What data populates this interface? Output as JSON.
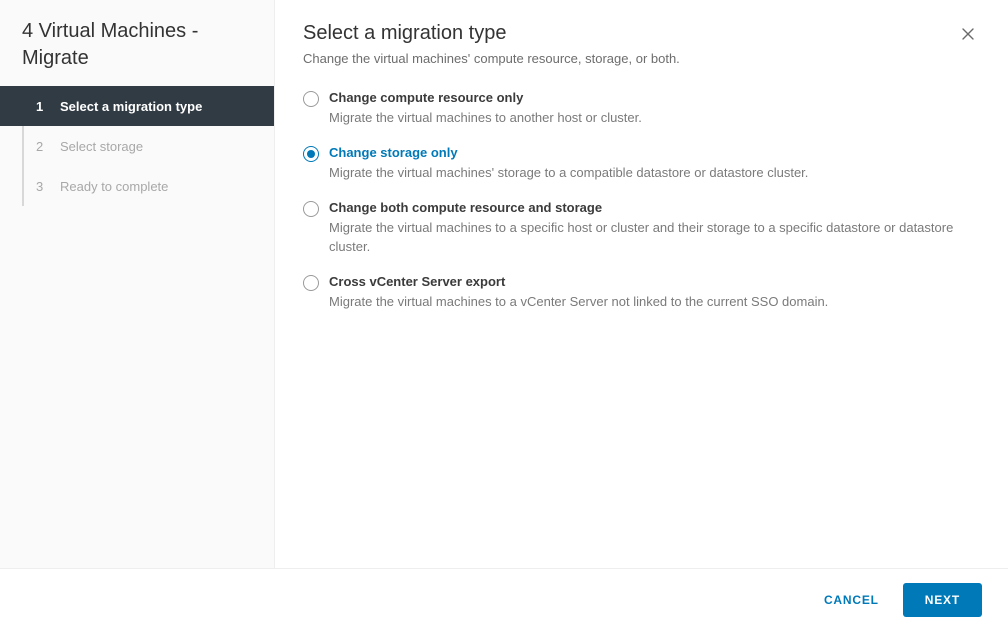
{
  "sidebar": {
    "title": "4 Virtual Machines - Migrate",
    "steps": [
      {
        "num": "1",
        "label": "Select a migration type",
        "state": "active"
      },
      {
        "num": "2",
        "label": "Select storage",
        "state": "pending"
      },
      {
        "num": "3",
        "label": "Ready to complete",
        "state": "pending"
      }
    ]
  },
  "content": {
    "title": "Select a migration type",
    "subtitle": "Change the virtual machines' compute resource, storage, or both.",
    "options": [
      {
        "label": "Change compute resource only",
        "desc": "Migrate the virtual machines to another host or cluster.",
        "selected": false
      },
      {
        "label": "Change storage only",
        "desc": "Migrate the virtual machines' storage to a compatible datastore or datastore cluster.",
        "selected": true
      },
      {
        "label": "Change both compute resource and storage",
        "desc": "Migrate the virtual machines to a specific host or cluster and their storage to a specific datastore or datastore cluster.",
        "selected": false
      },
      {
        "label": "Cross vCenter Server export",
        "desc": "Migrate the virtual machines to a vCenter Server not linked to the current SSO domain.",
        "selected": false
      }
    ]
  },
  "footer": {
    "cancel": "CANCEL",
    "next": "NEXT"
  }
}
